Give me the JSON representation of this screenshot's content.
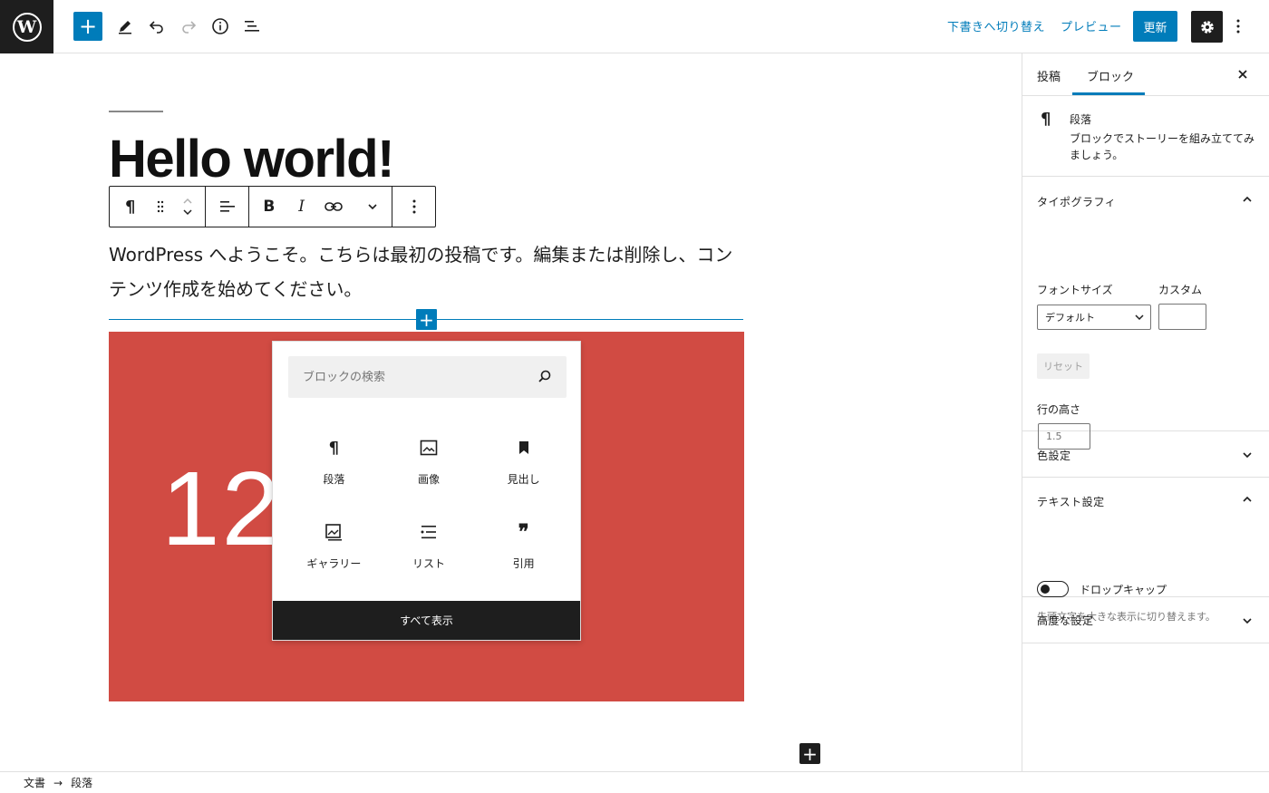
{
  "topbar": {
    "switch_draft": "下書きへ切り替え",
    "preview": "プレビュー",
    "update": "更新"
  },
  "editor": {
    "title": "Hello world!",
    "paragraph": "WordPress へようこそ。こちらは最初の投稿です。編集または削除し、コンテンツ作成を始めてください。",
    "cover_text": "12        00"
  },
  "inserter": {
    "search_placeholder": "ブロックの検索",
    "items": [
      {
        "label": "段落",
        "icon": "paragraph-icon"
      },
      {
        "label": "画像",
        "icon": "image-icon"
      },
      {
        "label": "見出し",
        "icon": "heading-icon"
      },
      {
        "label": "ギャラリー",
        "icon": "gallery-icon"
      },
      {
        "label": "リスト",
        "icon": "list-icon"
      },
      {
        "label": "引用",
        "icon": "quote-icon"
      }
    ],
    "browse_all": "すべて表示"
  },
  "breadcrumb": {
    "root": "文書",
    "arrow": "→",
    "current": "段落"
  },
  "sidebar": {
    "tab_post": "投稿",
    "tab_block": "ブロック",
    "block_name": "段落",
    "block_desc": "ブロックでストーリーを組み立ててみましょう。",
    "typography": {
      "title": "タイポグラフィ",
      "font_size_label": "フォントサイズ",
      "custom_label": "カスタム",
      "font_size_value": "デフォルト",
      "reset": "リセット",
      "line_height_label": "行の高さ",
      "line_height_placeholder": "1.5"
    },
    "color": {
      "title": "色設定"
    },
    "text": {
      "title": "テキスト設定",
      "drop_cap": "ドロップキャップ",
      "help": "先頭文字を大きな表示に切り替えます。"
    },
    "advanced": {
      "title": "高度な設定"
    }
  },
  "colors": {
    "accent": "#007cba",
    "cover": "#d14b43",
    "dark": "#1e1e1e"
  }
}
